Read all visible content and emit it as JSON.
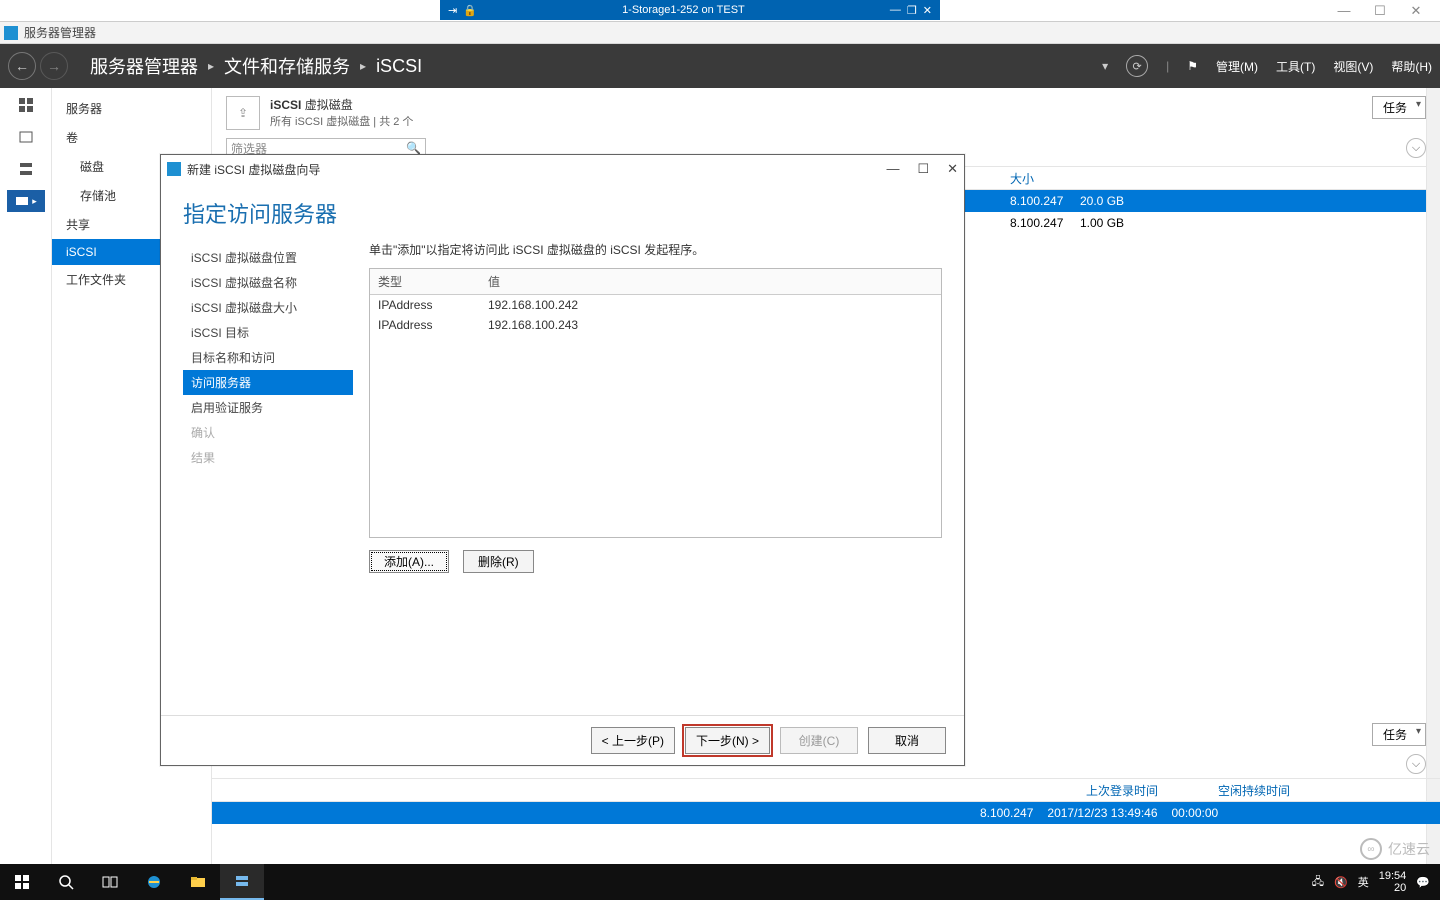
{
  "host_window": {
    "min": "—",
    "max": "☐",
    "close": "✕"
  },
  "vm_bar": {
    "pin": "⇥",
    "lock": "🔒",
    "title": "1-Storage1-252 on TEST",
    "min": "—",
    "max": "❐",
    "close": "✕"
  },
  "sm_title": "服务器管理器",
  "breadcrumb": {
    "root": "服务器管理器",
    "l1": "文件和存储服务",
    "l2": "iSCSI"
  },
  "menus": {
    "manage": "管理(M)",
    "tools": "工具(T)",
    "view": "视图(V)",
    "help": "帮助(H)"
  },
  "sidebar": {
    "items": [
      {
        "label": "服务器",
        "sub": false
      },
      {
        "label": "卷",
        "sub": false
      },
      {
        "label": "磁盘",
        "sub": true
      },
      {
        "label": "存储池",
        "sub": true
      },
      {
        "label": "共享",
        "sub": false
      },
      {
        "label": "iSCSI",
        "sub": false,
        "selected": true
      },
      {
        "label": "工作文件夹",
        "sub": false
      }
    ]
  },
  "panel": {
    "title_bold": "iSCSI",
    "title_rest": "虚拟磁盘",
    "subtitle": "所有 iSCSI 虚拟磁盘 | 共 2 个",
    "tasks": "任务",
    "size_col": "大小",
    "rows": [
      {
        "ip": "8.100.247",
        "size": "20.0 GB",
        "sel": true
      },
      {
        "ip": "8.100.247",
        "size": "1.00 GB",
        "sel": false
      }
    ]
  },
  "lower": {
    "tasks": "任务",
    "cols": {
      "c1": "上次登录时间",
      "c2": "空闲持续时间"
    },
    "row": {
      "ip": "8.100.247",
      "login": "2017/12/23 13:49:46",
      "idle": "00:00:00"
    }
  },
  "wizard": {
    "title": "新建 iSCSI 虚拟磁盘向导",
    "heading": "指定访问服务器",
    "steps": [
      {
        "label": "iSCSI 虚拟磁盘位置"
      },
      {
        "label": "iSCSI 虚拟磁盘名称"
      },
      {
        "label": "iSCSI 虚拟磁盘大小"
      },
      {
        "label": "iSCSI 目标"
      },
      {
        "label": "目标名称和访问"
      },
      {
        "label": "访问服务器",
        "active": true
      },
      {
        "label": "启用验证服务"
      },
      {
        "label": "确认",
        "disabled": true
      },
      {
        "label": "结果",
        "disabled": true
      }
    ],
    "instruction": "单击\"添加\"以指定将访问此 iSCSI 虚拟磁盘的 iSCSI 发起程序。",
    "table": {
      "headers": {
        "type": "类型",
        "value": "值"
      },
      "rows": [
        {
          "type": "IPAddress",
          "value": "192.168.100.242"
        },
        {
          "type": "IPAddress",
          "value": "192.168.100.243"
        }
      ]
    },
    "buttons": {
      "add": "添加(A)...",
      "remove": "删除(R)"
    },
    "footer": {
      "prev": "< 上一步(P)",
      "next": "下一步(N) >",
      "create": "创建(C)",
      "cancel": "取消"
    },
    "controls": {
      "min": "—",
      "max": "☐",
      "close": "✕"
    }
  },
  "taskbar": {
    "ime": "英",
    "time": "19:54",
    "date": "20"
  },
  "watermark": "亿速云"
}
